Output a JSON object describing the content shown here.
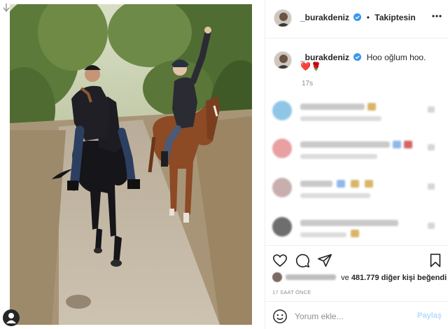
{
  "post": {
    "username": "_burakdeniz",
    "follow_status": "Takiptesin",
    "separator": "•",
    "caption_text": "Hoo oğlum hoo.",
    "caption_emoji": "❤️🌹",
    "caption_time": "17s",
    "likes_prefix": "ve",
    "likes_count": "481.779",
    "likes_suffix": "diğer kişi beğendi",
    "post_time": "17 SAAT ÖNCE",
    "comment_placeholder": "Yorum ekle...",
    "share_label": "Paylaş"
  },
  "photo": {
    "description_icon": "horse-riding-photo"
  },
  "colors": {
    "verified": "#3897f0",
    "share_disabled": "#b3dbff",
    "meta_gray": "#8e8e8e"
  }
}
